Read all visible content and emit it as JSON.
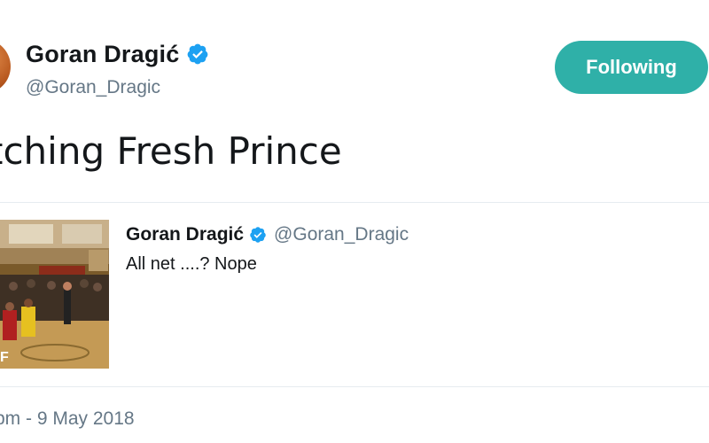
{
  "profile": {
    "display_name": "Goran Dragić",
    "handle": "@Goran_Dragic",
    "verified": true
  },
  "follow_button": {
    "label": "Following",
    "color": "#2fb0a8"
  },
  "tweet": {
    "text": "tching Fresh Prince",
    "timestamp": "pm - 9 May 2018"
  },
  "quoted_tweet": {
    "display_name": "Goran Dragić",
    "handle": "@Goran_Dragic",
    "text": "All net ....? Nope",
    "media": "basketball-gif-thumbnail"
  },
  "colors": {
    "text": "#14171a",
    "secondary": "#657786",
    "verified": "#1da1f2",
    "divider": "#e6ecf0"
  }
}
